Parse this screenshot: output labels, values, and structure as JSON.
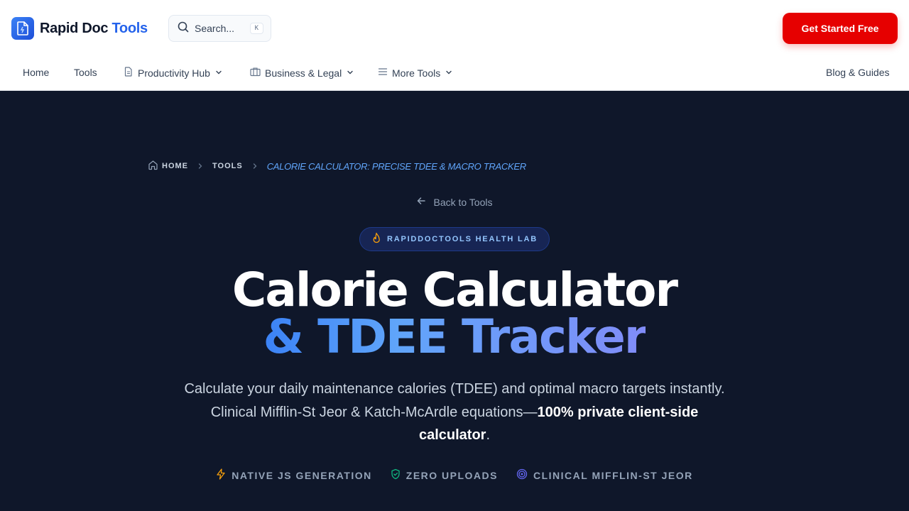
{
  "header": {
    "logo_text_main": "Rapid Doc",
    "logo_text_accent": "Tools",
    "search_placeholder": "Search...",
    "search_shortcut": "K",
    "cta_label": "Get Started Free"
  },
  "nav": {
    "items": [
      {
        "label": "Home"
      },
      {
        "label": "Tools"
      },
      {
        "label": "Productivity Hub"
      },
      {
        "label": "Business & Legal"
      },
      {
        "label": "More Tools"
      },
      {
        "label": "Blog & Guides"
      }
    ]
  },
  "hero": {
    "breadcrumb": {
      "home": "HOME",
      "tools": "TOOLS",
      "current": "CALORIE CALCULATOR: PRECISE TDEE & MACRO TRACKER"
    },
    "back_label": "Back to Tools",
    "badge_label": "RAPIDDOCTOOLS HEALTH LAB",
    "title_line1": "Calorie Calculator",
    "title_line2": "& TDEE Tracker",
    "lead_text": "Calculate your daily maintenance calories (TDEE) and optimal macro targets instantly. Clinical Mifflin-St Jeor & Katch-McArdle equations—",
    "lead_strong": "100% private client-side calculator",
    "lead_end": ".",
    "features": [
      {
        "label": "NATIVE JS GENERATION",
        "icon": "lightning-icon",
        "color": "#f59e0b"
      },
      {
        "label": "ZERO UPLOADS",
        "icon": "shield-check-icon",
        "color": "#10b981"
      },
      {
        "label": "CLINICAL MIFFLIN-ST JEOR",
        "icon": "target-icon",
        "color": "#6366f1"
      }
    ]
  },
  "colors": {
    "brand": "#2563eb",
    "cta": "#e60000",
    "hero_bg": "#0f172a"
  }
}
